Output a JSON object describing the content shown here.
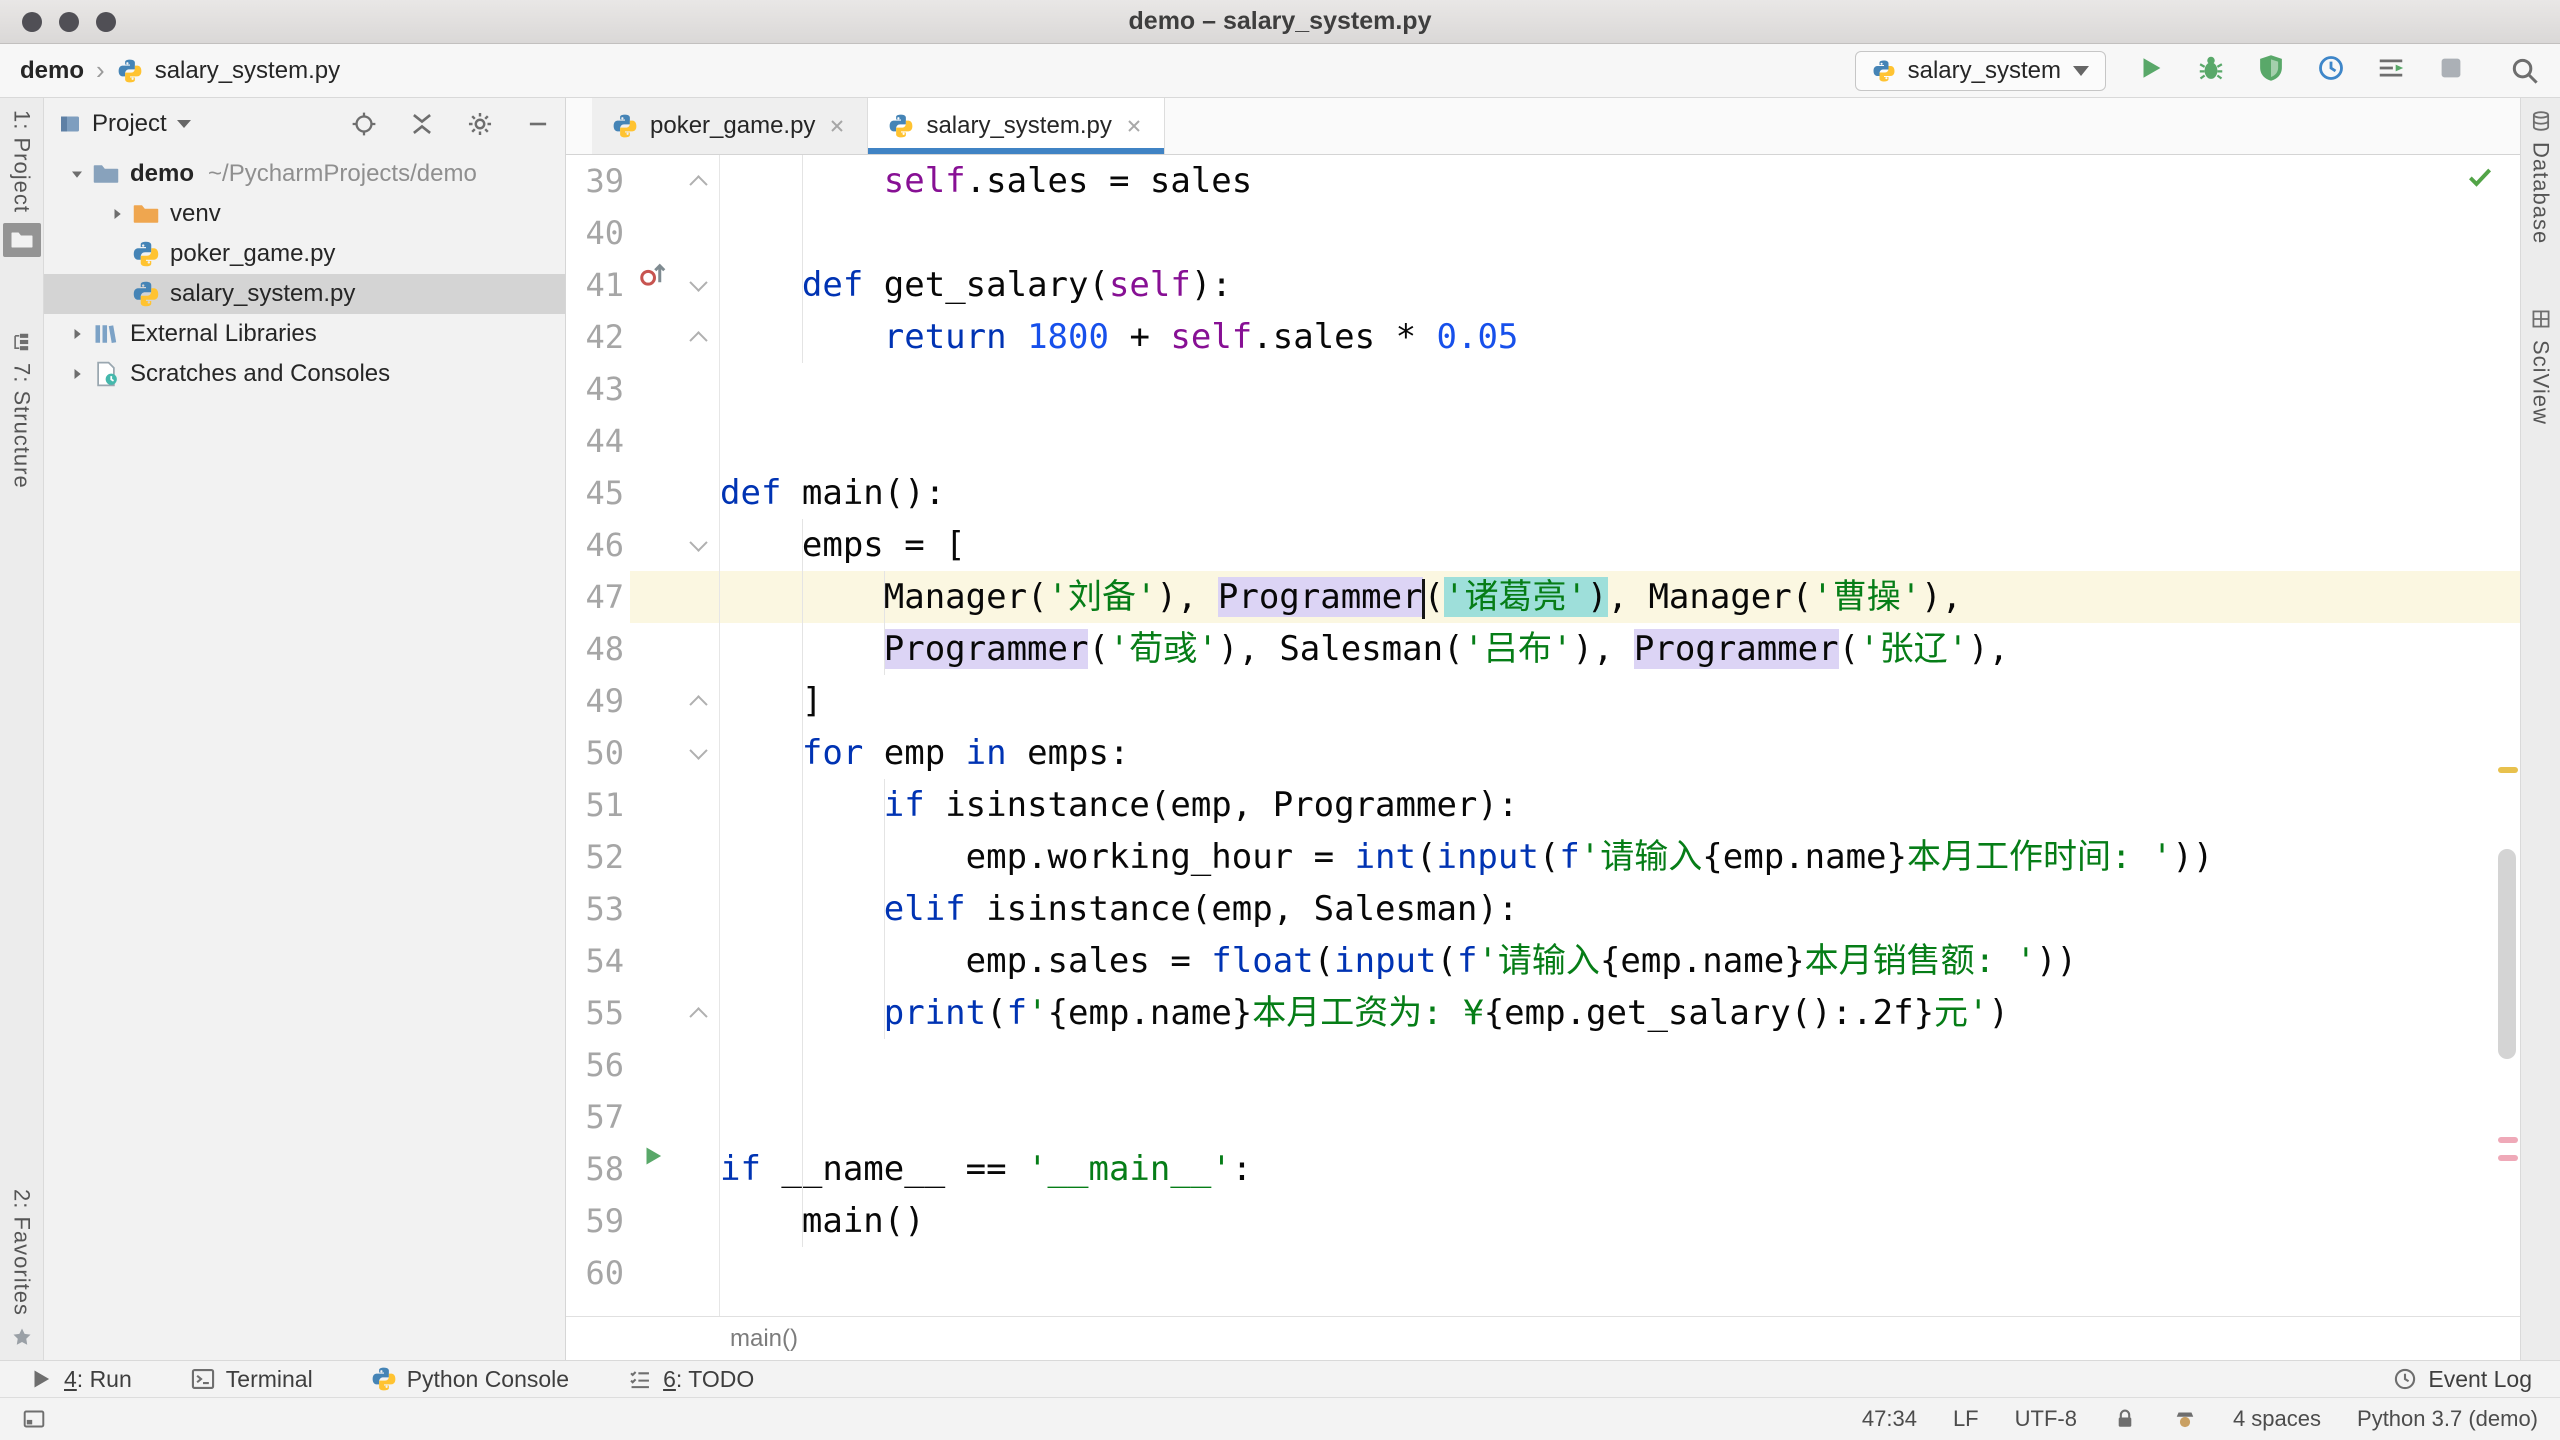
{
  "window": {
    "title": "demo – salary_system.py"
  },
  "navbar": {
    "breadcrumbs": [
      "demo",
      "salary_system.py"
    ],
    "separator": "›",
    "run_config": {
      "label": "salary_system"
    },
    "toolbar": [
      {
        "name": "run",
        "icon": "run-play"
      },
      {
        "name": "debug",
        "icon": "debug"
      },
      {
        "name": "coverage",
        "icon": "coverage"
      },
      {
        "name": "profiler",
        "icon": "profiler"
      },
      {
        "name": "concurrency",
        "icon": "concurrency"
      },
      {
        "name": "stop",
        "icon": "stop"
      }
    ]
  },
  "stripes": {
    "left_top": [
      {
        "label": "1: Project",
        "icon": "folder-active"
      },
      {
        "label": "7: Structure",
        "icon": "structure"
      }
    ],
    "left_bottom": [
      {
        "label": "2: Favorites",
        "icon": "star"
      }
    ],
    "right": [
      {
        "label": "Database",
        "icon": "database"
      },
      {
        "label": "SciView",
        "icon": "grid"
      }
    ]
  },
  "project_panel": {
    "title": "Project",
    "tree": [
      {
        "label": "demo",
        "hint": "~/PycharmProjects/demo",
        "icon": "folder-blue",
        "chevron": "down",
        "level": 0,
        "bold": true
      },
      {
        "label": "venv",
        "icon": "folder-orange",
        "chevron": "right",
        "level": 1
      },
      {
        "label": "poker_game.py",
        "icon": "python",
        "level": 1
      },
      {
        "label": "salary_system.py",
        "icon": "python",
        "level": 1,
        "selected": true
      },
      {
        "label": "External Libraries",
        "icon": "library",
        "chevron": "right",
        "level": 0
      },
      {
        "label": "Scratches and Consoles",
        "icon": "scratch",
        "chevron": "right",
        "level": 0
      }
    ]
  },
  "tabs": [
    {
      "label": "poker_game.py"
    },
    {
      "label": "salary_system.py",
      "active": true
    }
  ],
  "editor": {
    "breadcrumb": "main()",
    "lines": [
      {
        "n": 39,
        "fold": "up",
        "segs": [
          [
            "p",
            "        "
          ],
          [
            "f",
            "self"
          ],
          [
            "p",
            ".sales = sales"
          ]
        ]
      },
      {
        "n": 40,
        "segs": []
      },
      {
        "n": 41,
        "icon": "override",
        "fold": "down",
        "segs": [
          [
            "p",
            "    "
          ],
          [
            "k",
            "def"
          ],
          [
            "p",
            " get_salary("
          ],
          [
            "f",
            "self"
          ],
          [
            "p",
            "):"
          ]
        ]
      },
      {
        "n": 42,
        "fold": "up",
        "segs": [
          [
            "p",
            "        "
          ],
          [
            "k",
            "return"
          ],
          [
            "p",
            " "
          ],
          [
            "n",
            "1800"
          ],
          [
            "p",
            " + "
          ],
          [
            "f",
            "self"
          ],
          [
            "p",
            ".sales * "
          ],
          [
            "n",
            "0.05"
          ]
        ]
      },
      {
        "n": 43,
        "segs": []
      },
      {
        "n": 44,
        "segs": []
      },
      {
        "n": 45,
        "segs": [
          [
            "k",
            "def"
          ],
          [
            "p",
            " main():"
          ]
        ]
      },
      {
        "n": 46,
        "fold": "down",
        "segs": [
          [
            "p",
            "    emps = ["
          ]
        ]
      },
      {
        "n": 47,
        "current": true,
        "segs": [
          [
            "p",
            "        Manager("
          ],
          [
            "s",
            "'刘备'"
          ],
          [
            "p",
            "), "
          ],
          [
            "h",
            "Programmer"
          ],
          [
            "caret",
            ""
          ],
          [
            "p",
            "("
          ],
          [
            "ss",
            "'诸葛亮'"
          ],
          [
            "ps",
            ")"
          ],
          [
            "p",
            ", Manager("
          ],
          [
            "s",
            "'曹操'"
          ],
          [
            "p",
            "),"
          ]
        ]
      },
      {
        "n": 48,
        "segs": [
          [
            "p",
            "        "
          ],
          [
            "h",
            "Programmer"
          ],
          [
            "p",
            "("
          ],
          [
            "s",
            "'荀彧'"
          ],
          [
            "p",
            "), Salesman("
          ],
          [
            "s",
            "'吕布'"
          ],
          [
            "p",
            "), "
          ],
          [
            "h",
            "Programmer"
          ],
          [
            "p",
            "("
          ],
          [
            "s",
            "'张辽'"
          ],
          [
            "p",
            "),"
          ]
        ]
      },
      {
        "n": 49,
        "fold": "up",
        "segs": [
          [
            "p",
            "    ]"
          ]
        ]
      },
      {
        "n": 50,
        "fold": "down",
        "segs": [
          [
            "p",
            "    "
          ],
          [
            "k",
            "for"
          ],
          [
            "p",
            " emp "
          ],
          [
            "k",
            "in"
          ],
          [
            "p",
            " emps:"
          ]
        ]
      },
      {
        "n": 51,
        "segs": [
          [
            "p",
            "        "
          ],
          [
            "k",
            "if"
          ],
          [
            "p",
            " isinstance(emp, Programmer):"
          ]
        ]
      },
      {
        "n": 52,
        "segs": [
          [
            "p",
            "            emp.working_hour = "
          ],
          [
            "k",
            "int"
          ],
          [
            "p",
            "("
          ],
          [
            "k",
            "input"
          ],
          [
            "p",
            "("
          ],
          [
            "k",
            "f"
          ],
          [
            "s",
            "'请输入"
          ],
          [
            "p",
            "{emp.name}"
          ],
          [
            "s",
            "本月工作时间: '"
          ],
          [
            "p",
            "))"
          ]
        ]
      },
      {
        "n": 53,
        "segs": [
          [
            "p",
            "        "
          ],
          [
            "k",
            "elif"
          ],
          [
            "p",
            " isinstance(emp, Salesman):"
          ]
        ]
      },
      {
        "n": 54,
        "segs": [
          [
            "p",
            "            emp.sales = "
          ],
          [
            "k",
            "float"
          ],
          [
            "p",
            "("
          ],
          [
            "k",
            "input"
          ],
          [
            "p",
            "("
          ],
          [
            "k",
            "f"
          ],
          [
            "s",
            "'请输入"
          ],
          [
            "p",
            "{emp.name}"
          ],
          [
            "s",
            "本月销售额: '"
          ],
          [
            "p",
            "))"
          ]
        ]
      },
      {
        "n": 55,
        "fold": "up",
        "segs": [
          [
            "p",
            "        "
          ],
          [
            "k",
            "print"
          ],
          [
            "p",
            "("
          ],
          [
            "k",
            "f"
          ],
          [
            "s",
            "'"
          ],
          [
            "p",
            "{emp.name}"
          ],
          [
            "s",
            "本月工资为: ¥"
          ],
          [
            "p",
            "{emp.get_salary():.2f}"
          ],
          [
            "s",
            "元'"
          ],
          [
            "p",
            ")"
          ]
        ]
      },
      {
        "n": 56,
        "segs": []
      },
      {
        "n": 57,
        "segs": []
      },
      {
        "n": 58,
        "icon": "run",
        "segs": [
          [
            "k",
            "if"
          ],
          [
            "p",
            " __name__ == "
          ],
          [
            "s",
            "'__main__'"
          ],
          [
            "p",
            ":"
          ]
        ]
      },
      {
        "n": 59,
        "segs": [
          [
            "p",
            "    main()"
          ]
        ]
      },
      {
        "n": 60,
        "segs": []
      }
    ]
  },
  "bottom_bar": {
    "left": [
      {
        "mnemonic": "4",
        "label": "Run",
        "icon": "run-gray"
      },
      {
        "label": "Terminal",
        "icon": "terminal"
      },
      {
        "label": "Python Console",
        "icon": "python"
      },
      {
        "mnemonic": "6",
        "label": "TODO",
        "icon": "todo"
      }
    ],
    "right": [
      {
        "label": "Event Log",
        "icon": "clock"
      }
    ]
  },
  "status_bar": {
    "items": [
      {
        "text": "47:34"
      },
      {
        "text": "LF"
      },
      {
        "text": "UTF-8"
      },
      {
        "icon": "lock"
      },
      {
        "icon": "inspector"
      },
      {
        "text": "4 spaces"
      },
      {
        "text": "Python 3.7 (demo)"
      }
    ]
  }
}
